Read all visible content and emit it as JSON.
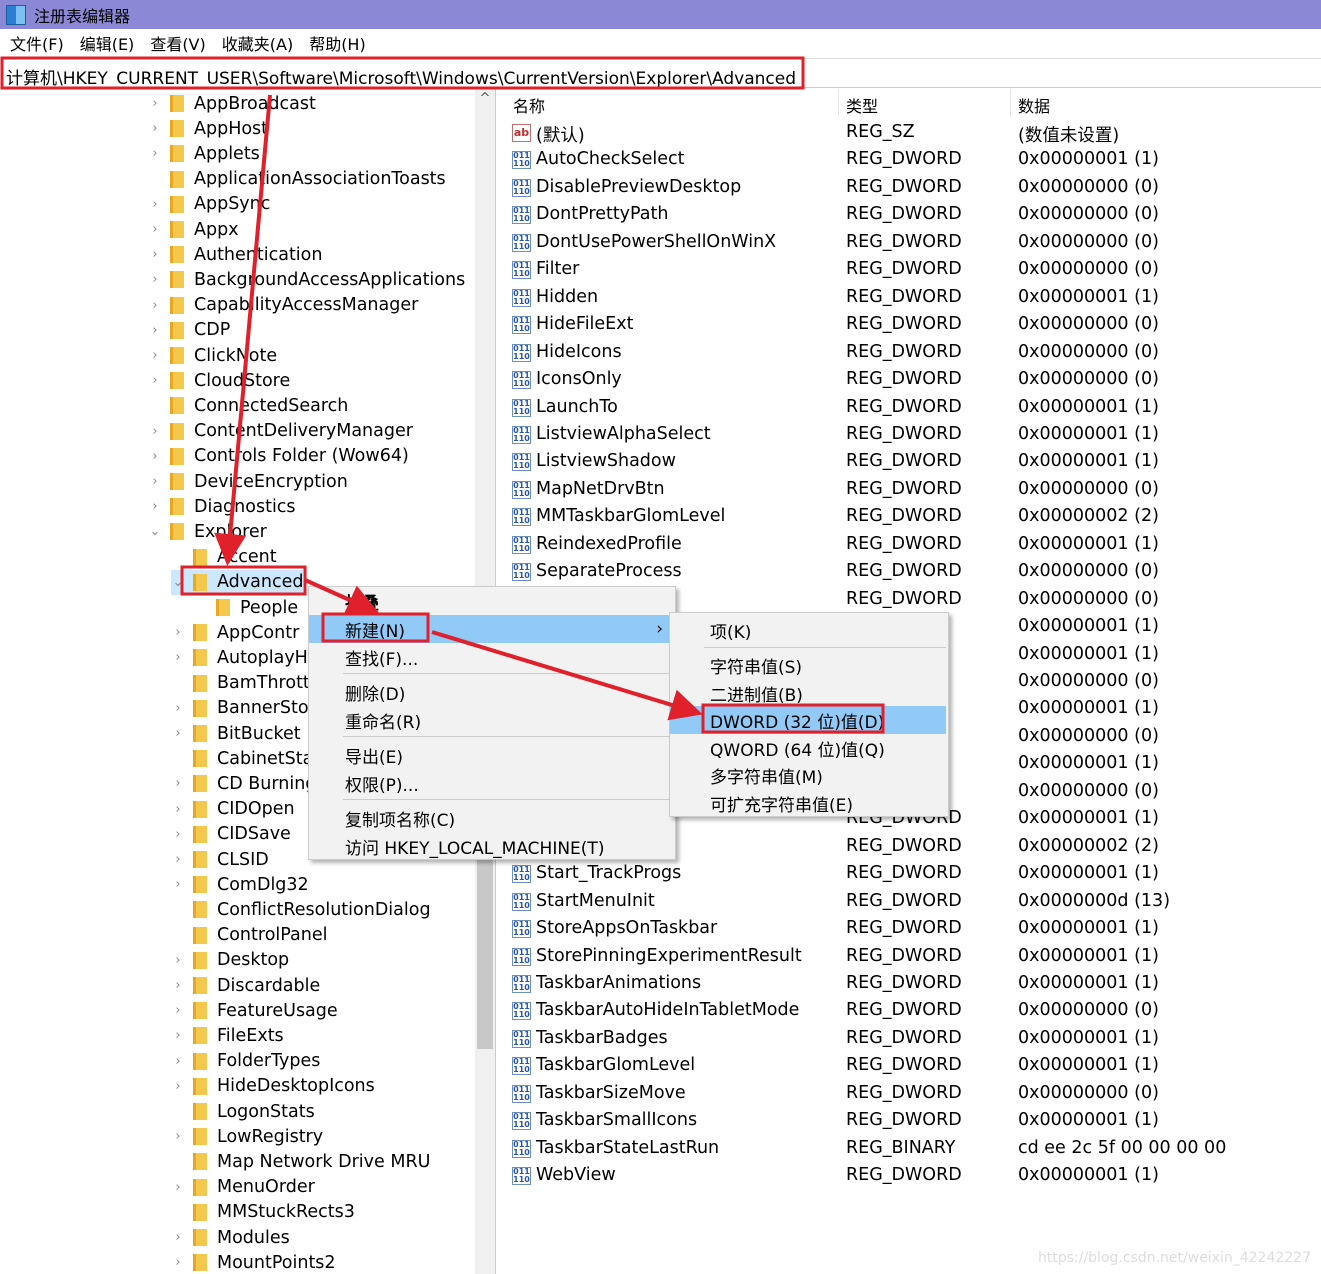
{
  "window": {
    "title": "注册表编辑器"
  },
  "menubar": [
    "文件(F)",
    "编辑(E)",
    "查看(V)",
    "收藏夹(A)",
    "帮助(H)"
  ],
  "address": "计算机\\HKEY_CURRENT_USER\\Software\\Microsoft\\Windows\\CurrentVersion\\Explorer\\Advanced",
  "tree": [
    {
      "label": "AppBroadcast",
      "level": 1,
      "exp": ">"
    },
    {
      "label": "AppHost",
      "level": 1,
      "exp": ">"
    },
    {
      "label": "Applets",
      "level": 1,
      "exp": ">"
    },
    {
      "label": "ApplicationAssociationToasts",
      "level": 1,
      "exp": ""
    },
    {
      "label": "AppSync",
      "level": 1,
      "exp": ">"
    },
    {
      "label": "Appx",
      "level": 1,
      "exp": ">"
    },
    {
      "label": "Authentication",
      "level": 1,
      "exp": ">"
    },
    {
      "label": "BackgroundAccessApplications",
      "level": 1,
      "exp": ">"
    },
    {
      "label": "CapabilityAccessManager",
      "level": 1,
      "exp": ">"
    },
    {
      "label": "CDP",
      "level": 1,
      "exp": ">"
    },
    {
      "label": "ClickNote",
      "level": 1,
      "exp": ">"
    },
    {
      "label": "CloudStore",
      "level": 1,
      "exp": ">"
    },
    {
      "label": "ConnectedSearch",
      "level": 1,
      "exp": ""
    },
    {
      "label": "ContentDeliveryManager",
      "level": 1,
      "exp": ">"
    },
    {
      "label": "Controls Folder (Wow64)",
      "level": 1,
      "exp": ">"
    },
    {
      "label": "DeviceEncryption",
      "level": 1,
      "exp": ">"
    },
    {
      "label": "Diagnostics",
      "level": 1,
      "exp": ">"
    },
    {
      "label": "Explorer",
      "level": 1,
      "exp": "v"
    },
    {
      "label": "Accent",
      "level": 2,
      "exp": ""
    },
    {
      "label": "Advanced",
      "level": 2,
      "exp": "v",
      "selected": true
    },
    {
      "label": "People",
      "level": 3,
      "exp": ""
    },
    {
      "label": "AppContr",
      "level": 2,
      "exp": ">"
    },
    {
      "label": "AutoplayH",
      "level": 2,
      "exp": ">"
    },
    {
      "label": "BamThrott",
      "level": 2,
      "exp": ""
    },
    {
      "label": "BannerSto",
      "level": 2,
      "exp": ">"
    },
    {
      "label": "BitBucket",
      "level": 2,
      "exp": ">"
    },
    {
      "label": "CabinetSta",
      "level": 2,
      "exp": ""
    },
    {
      "label": "CD Burning",
      "level": 2,
      "exp": ">"
    },
    {
      "label": "CIDOpen",
      "level": 2,
      "exp": ">"
    },
    {
      "label": "CIDSave",
      "level": 2,
      "exp": ">"
    },
    {
      "label": "CLSID",
      "level": 2,
      "exp": ">"
    },
    {
      "label": "ComDlg32",
      "level": 2,
      "exp": ">"
    },
    {
      "label": "ConflictResolutionDialog",
      "level": 2,
      "exp": ""
    },
    {
      "label": "ControlPanel",
      "level": 2,
      "exp": ""
    },
    {
      "label": "Desktop",
      "level": 2,
      "exp": ">"
    },
    {
      "label": "Discardable",
      "level": 2,
      "exp": ">"
    },
    {
      "label": "FeatureUsage",
      "level": 2,
      "exp": ">"
    },
    {
      "label": "FileExts",
      "level": 2,
      "exp": ">"
    },
    {
      "label": "FolderTypes",
      "level": 2,
      "exp": ">"
    },
    {
      "label": "HideDesktopIcons",
      "level": 2,
      "exp": ">"
    },
    {
      "label": "LogonStats",
      "level": 2,
      "exp": ""
    },
    {
      "label": "LowRegistry",
      "level": 2,
      "exp": ">"
    },
    {
      "label": "Map Network Drive MRU",
      "level": 2,
      "exp": ""
    },
    {
      "label": "MenuOrder",
      "level": 2,
      "exp": ">"
    },
    {
      "label": "MMStuckRects3",
      "level": 2,
      "exp": ""
    },
    {
      "label": "Modules",
      "level": 2,
      "exp": ">"
    },
    {
      "label": "MountPoints2",
      "level": 2,
      "exp": ">"
    }
  ],
  "columns": {
    "name": "名称",
    "type": "类型",
    "data": "数据"
  },
  "values": [
    {
      "name": "(默认)",
      "type": "REG_SZ",
      "data": "(数值未设置)",
      "icon": "string"
    },
    {
      "name": "AutoCheckSelect",
      "type": "REG_DWORD",
      "data": "0x00000001 (1)"
    },
    {
      "name": "DisablePreviewDesktop",
      "type": "REG_DWORD",
      "data": "0x00000000 (0)"
    },
    {
      "name": "DontPrettyPath",
      "type": "REG_DWORD",
      "data": "0x00000000 (0)"
    },
    {
      "name": "DontUsePowerShellOnWinX",
      "type": "REG_DWORD",
      "data": "0x00000000 (0)"
    },
    {
      "name": "Filter",
      "type": "REG_DWORD",
      "data": "0x00000000 (0)"
    },
    {
      "name": "Hidden",
      "type": "REG_DWORD",
      "data": "0x00000001 (1)"
    },
    {
      "name": "HideFileExt",
      "type": "REG_DWORD",
      "data": "0x00000000 (0)"
    },
    {
      "name": "HideIcons",
      "type": "REG_DWORD",
      "data": "0x00000000 (0)"
    },
    {
      "name": "IconsOnly",
      "type": "REG_DWORD",
      "data": "0x00000000 (0)"
    },
    {
      "name": "LaunchTo",
      "type": "REG_DWORD",
      "data": "0x00000001 (1)"
    },
    {
      "name": "ListviewAlphaSelect",
      "type": "REG_DWORD",
      "data": "0x00000001 (1)"
    },
    {
      "name": "ListviewShadow",
      "type": "REG_DWORD",
      "data": "0x00000001 (1)"
    },
    {
      "name": "MapNetDrvBtn",
      "type": "REG_DWORD",
      "data": "0x00000000 (0)"
    },
    {
      "name": "MMTaskbarGlomLevel",
      "type": "REG_DWORD",
      "data": "0x00000002 (2)"
    },
    {
      "name": "ReindexedProfile",
      "type": "REG_DWORD",
      "data": "0x00000001 (1)"
    },
    {
      "name": "SeparateProcess",
      "type": "REG_DWORD",
      "data": "0x00000000 (0)"
    },
    {
      "name": "",
      "type": "REG_DWORD",
      "data": "0x00000000 (0)"
    },
    {
      "name": "",
      "type": "",
      "data": "0x00000001 (1)"
    },
    {
      "name": "",
      "type": "",
      "data": "0x00000001 (1)"
    },
    {
      "name": "",
      "type": "",
      "data": "0x00000000 (0)"
    },
    {
      "name": "",
      "type": "",
      "data": "0x00000001 (1)"
    },
    {
      "name": "",
      "type": "",
      "data": "0x00000000 (0)"
    },
    {
      "name": "",
      "type": "",
      "data": "0x00000001 (1)"
    },
    {
      "name": "",
      "type": "",
      "data": "0x00000000 (0)"
    },
    {
      "name": "",
      "type": "REG_DWORD",
      "data": "0x00000001 (1)"
    },
    {
      "name": "",
      "type": "REG_DWORD",
      "data": "0x00000002 (2)"
    },
    {
      "name": "Start_TrackProgs",
      "type": "REG_DWORD",
      "data": "0x00000001 (1)"
    },
    {
      "name": "StartMenuInit",
      "type": "REG_DWORD",
      "data": "0x0000000d (13)"
    },
    {
      "name": "StoreAppsOnTaskbar",
      "type": "REG_DWORD",
      "data": "0x00000001 (1)"
    },
    {
      "name": "StorePinningExperimentResult",
      "type": "REG_DWORD",
      "data": "0x00000001 (1)"
    },
    {
      "name": "TaskbarAnimations",
      "type": "REG_DWORD",
      "data": "0x00000001 (1)"
    },
    {
      "name": "TaskbarAutoHideInTabletMode",
      "type": "REG_DWORD",
      "data": "0x00000000 (0)"
    },
    {
      "name": "TaskbarBadges",
      "type": "REG_DWORD",
      "data": "0x00000001 (1)"
    },
    {
      "name": "TaskbarGlomLevel",
      "type": "REG_DWORD",
      "data": "0x00000001 (1)"
    },
    {
      "name": "TaskbarSizeMove",
      "type": "REG_DWORD",
      "data": "0x00000000 (0)"
    },
    {
      "name": "TaskbarSmallIcons",
      "type": "REG_DWORD",
      "data": "0x00000001 (1)"
    },
    {
      "name": "TaskbarStateLastRun",
      "type": "REG_BINARY",
      "data": "cd ee 2c 5f 00 00 00 00"
    },
    {
      "name": "WebView",
      "type": "REG_DWORD",
      "data": "0x00000001 (1)"
    }
  ],
  "context_menu": [
    "折叠",
    "新建(N)",
    "查找(F)...",
    "删除(D)",
    "重命名(R)",
    "导出(E)",
    "权限(P)...",
    "复制项名称(C)",
    "访问 HKEY_LOCAL_MACHINE(T)"
  ],
  "submenu": [
    "项(K)",
    "字符串值(S)",
    "二进制值(B)",
    "DWORD (32 位)值(D)",
    "QWORD (64 位)值(Q)",
    "多字符串值(M)",
    "可扩充字符串值(E)"
  ],
  "watermark": "https://blog.csdn.net/weixin_42242227",
  "colors": {
    "title": "#8b89d6",
    "highlight": "#91c9f7",
    "annotation": "#e0202a"
  }
}
